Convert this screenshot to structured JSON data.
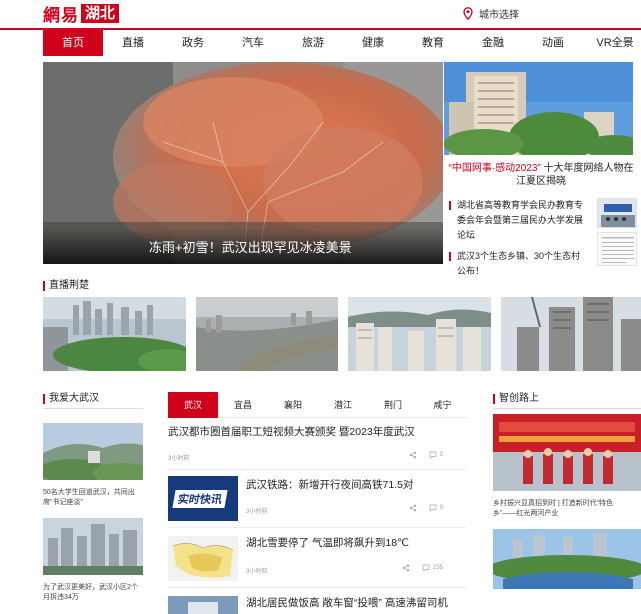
{
  "header": {
    "logo_main": "網易",
    "logo_region": "湖北",
    "city_select": "城市选择"
  },
  "nav": {
    "items": [
      {
        "label": "首页",
        "active": true
      },
      {
        "label": "直播",
        "active": false
      },
      {
        "label": "政务",
        "active": false
      },
      {
        "label": "汽车",
        "active": false
      },
      {
        "label": "旅游",
        "active": false
      },
      {
        "label": "健康",
        "active": false
      },
      {
        "label": "教育",
        "active": false
      },
      {
        "label": "金融",
        "active": false
      },
      {
        "label": "动画",
        "active": false
      },
      {
        "label": "VR全景",
        "active": false
      }
    ]
  },
  "hero": {
    "caption": "冻雨+初雪！武汉出现罕见冰凌美景"
  },
  "side": {
    "title_prefix": "“中国网事·感动2023”",
    "title_rest": "十大年度网络人物在江夏区揭晓",
    "list": [
      "湖北省高等教育学会民办教育专委会年会暨第三届民办大学发展论坛",
      "武汉3个生态乡镇、30个生态村公布！"
    ]
  },
  "sections": {
    "live": "直播荆楚",
    "love_wuhan": "我爱大武汉",
    "on_the_way": "智创路上"
  },
  "tabs": {
    "items": [
      {
        "label": "武汉",
        "active": true
      },
      {
        "label": "宜昌",
        "active": false
      },
      {
        "label": "襄阳",
        "active": false
      },
      {
        "label": "潜江",
        "active": false
      },
      {
        "label": "荆门",
        "active": false
      },
      {
        "label": "咸宁",
        "active": false
      }
    ]
  },
  "news": [
    {
      "title": "武汉都市圈首届职工短视频大赛颁奖 暨2023年度武汉",
      "meta": "3小时前",
      "count": "0",
      "has_thumb": false
    },
    {
      "title": "武汉铁路：新增开行夜间高铁71.5对",
      "meta": "3小时前",
      "count": "0",
      "has_thumb": true,
      "thumb_text": "实时快讯"
    },
    {
      "title": "湖北雪要停了 气温即将飙升到18℃",
      "meta": "3小时前",
      "count": "155",
      "has_thumb": true
    },
    {
      "title": "湖北居民做饭高 敞车窗“投喂” 高速沸留司机",
      "meta": "",
      "count": "",
      "has_thumb": true
    }
  ],
  "left_col": [
    {
      "caption": "50名大学生回道武汉，共同出席“书记座谈”"
    },
    {
      "caption": "为了武汉更美好，武汉小区2个月拆违34万"
    }
  ],
  "right_col": [
    {
      "caption": "乡村振兴显真招到时 | 打造新时代“特色乡”——红光两河产业"
    }
  ],
  "colors": {
    "brand_red": "#d0021b"
  }
}
